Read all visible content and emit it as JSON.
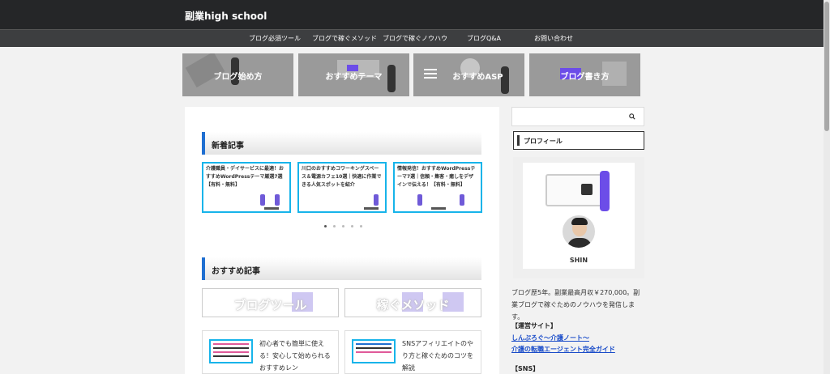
{
  "header": {
    "site_title": "副業high school"
  },
  "nav": {
    "items": [
      "ブログ必須ツール",
      "ブログで稼ぐメソッド",
      "ブログで稼ぐノウハウ",
      "ブログQ&A",
      "お問い合わせ"
    ]
  },
  "categories": [
    "ブログ始め方",
    "おすすめテーマ",
    "おすすめASP",
    "ブログ書き方"
  ],
  "new_posts": {
    "heading": "新着記事",
    "cards": [
      "介護職員・デイサービスに最適！おすすめWordPressテーマ厳選7選【有料・無料】",
      "川口のおすすめコワーキングスペース＆電源カフェ10選｜快適に作業できる人気スポットを紹介",
      "情報発信！おすすめWordPressテーマ7選｜信頼・集客・癒しをデザインで伝える！【有料・無料】"
    ]
  },
  "recommended": {
    "heading": "おすすめ記事",
    "buttons": [
      "ブログツール",
      "稼ぐメソッド"
    ],
    "cards": [
      "初心者でも簡単に使える！安心して始められるおすすめレン",
      "SNSアフィリエイトのやり方と稼ぐためのコツを解説"
    ]
  },
  "sidebar": {
    "search_placeholder": "",
    "profile_heading": "プロフィール",
    "profile_name": "SHIN",
    "profile_text": "ブログ歴5年。副業最高月収￥270,000。副業ブログで稼ぐためのノウハウを発信します。",
    "managed_sites_label": "【運営サイト】",
    "managed_sites": [
      "しんぷろぐ〜介護ノート〜",
      "介護の転職エージェント完全ガイド"
    ],
    "sns_label": "【SNS】"
  },
  "colors": {
    "accent": "#1f6fd1",
    "header_bg": "#252628",
    "nav_bg": "#3d3e40",
    "card_border": "#17b4ea",
    "link": "#1a4cc9"
  }
}
